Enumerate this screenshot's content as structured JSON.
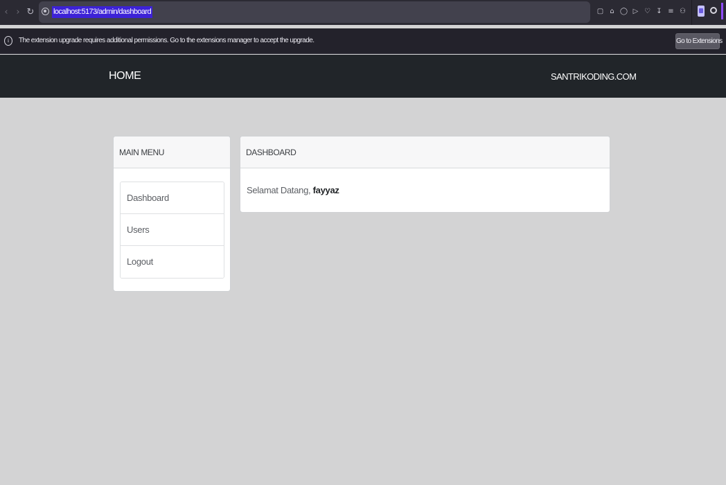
{
  "browser": {
    "url": "localhost:5173/admin/dashboard",
    "nav_icons": [
      "back-icon",
      "forward-icon",
      "reload-icon"
    ],
    "toolbar_icons": [
      "bookmark-icon",
      "home-icon",
      "shield-icon",
      "play-icon",
      "heart-icon",
      "download-icon",
      "library-icon",
      "account-icon"
    ]
  },
  "notification": {
    "message": "The extension upgrade requires additional permissions. Go to the extensions manager to accept the upgrade.",
    "button_label": "Go to Extensions"
  },
  "navbar": {
    "brand": "HOME",
    "right_link": "SANTRIKODING.COM"
  },
  "sidebar": {
    "title": "MAIN MENU",
    "items": [
      {
        "label": "Dashboard"
      },
      {
        "label": "Users"
      },
      {
        "label": "Logout"
      }
    ]
  },
  "dashboard": {
    "title": "DASHBOARD",
    "greeting": "Selamat Datang,",
    "username": "fayyaz"
  },
  "colors": {
    "page_bg": "#d3d3d4",
    "navbar_bg": "#212529",
    "url_highlight": "#3d22d7"
  }
}
